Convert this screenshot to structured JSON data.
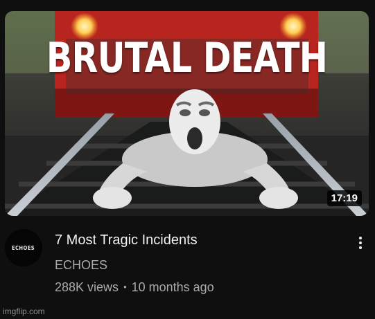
{
  "video": {
    "thumbnail_text": "BRUTAL DEATH",
    "duration": "17:19",
    "title": "7 Most Tragic Incidents",
    "channel": {
      "name": "ECHOES",
      "avatar_text": "ECHOES"
    },
    "views": "288K views",
    "separator": "•",
    "age": "10 months ago"
  },
  "watermark": "imgflip.com",
  "icons": {
    "more_actions": "more-vert-icon"
  },
  "colors": {
    "background": "#0f0f0f",
    "primary_text": "#f1f1f1",
    "secondary_text": "#aaaaaa",
    "train_red": "#b8241e"
  }
}
